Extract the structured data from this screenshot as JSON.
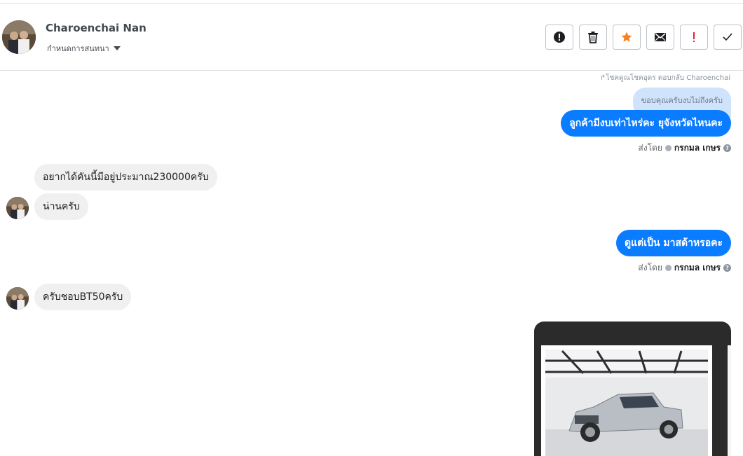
{
  "header": {
    "contact_name": "Charoenchai Nan",
    "assign_label": "กำหนดการสนทนา",
    "actions": [
      {
        "name": "mark-spam-button",
        "icon": "exclamation-circle-icon"
      },
      {
        "name": "delete-button",
        "icon": "trash-icon"
      },
      {
        "name": "star-button",
        "icon": "star-icon",
        "color": "#f5821f"
      },
      {
        "name": "mark-unread-button",
        "icon": "envelope-icon"
      },
      {
        "name": "follow-up-button",
        "icon": "exclamation-icon",
        "color": "#e41e3f"
      },
      {
        "name": "mark-done-button",
        "icon": "check-icon"
      }
    ]
  },
  "thread": {
    "reply_note": "↱โชคดูณโชคอุดร ตอบกลับ Charoenchai",
    "quoted_text": "ขอบคุณครับงบไม่ถึงครับ",
    "messages": [
      {
        "direction": "out",
        "text": "ลูกค้ามีงบเท่าไหร่คะ ยุจังหวัดไหนคะ"
      },
      {
        "direction": "in",
        "text": "อยากได้คันนี้มีอยู่ประมาณ230000ครับ"
      },
      {
        "direction": "in",
        "text": "น่านครับ"
      },
      {
        "direction": "out",
        "text": "ดูแต่เป็น มาสด้าหรอคะ"
      },
      {
        "direction": "in",
        "text": "ครับชอบBT50ครับ"
      }
    ],
    "sent_by_label": "ส่งโดย",
    "agent_name": "กรกมล เกษร",
    "help_symbol": "?"
  },
  "colors": {
    "outgoing_bubble": "#0a7cff",
    "incoming_bubble": "#f0f0f0",
    "quoted_bubble": "#cfe3fb"
  }
}
